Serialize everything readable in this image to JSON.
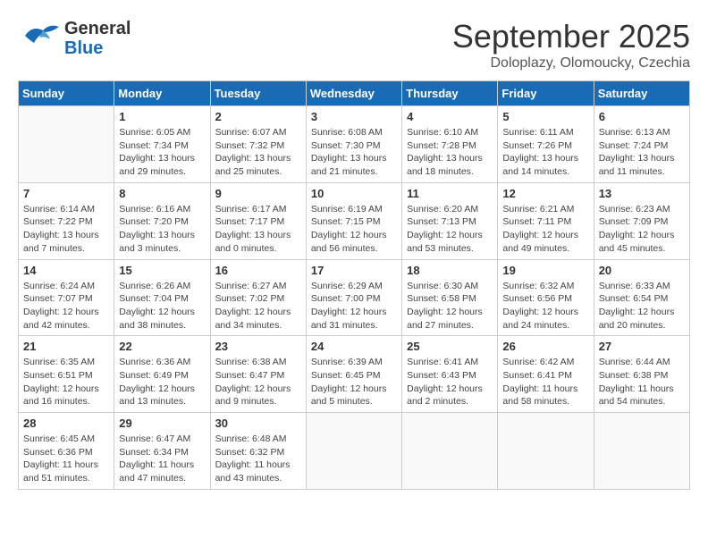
{
  "header": {
    "logo_line1": "General",
    "logo_line2": "Blue",
    "month_title": "September 2025",
    "subtitle": "Doloplazy, Olomoucky, Czechia"
  },
  "days_of_week": [
    "Sunday",
    "Monday",
    "Tuesday",
    "Wednesday",
    "Thursday",
    "Friday",
    "Saturday"
  ],
  "weeks": [
    [
      {
        "day": "",
        "info": ""
      },
      {
        "day": "1",
        "info": "Sunrise: 6:05 AM\nSunset: 7:34 PM\nDaylight: 13 hours\nand 29 minutes."
      },
      {
        "day": "2",
        "info": "Sunrise: 6:07 AM\nSunset: 7:32 PM\nDaylight: 13 hours\nand 25 minutes."
      },
      {
        "day": "3",
        "info": "Sunrise: 6:08 AM\nSunset: 7:30 PM\nDaylight: 13 hours\nand 21 minutes."
      },
      {
        "day": "4",
        "info": "Sunrise: 6:10 AM\nSunset: 7:28 PM\nDaylight: 13 hours\nand 18 minutes."
      },
      {
        "day": "5",
        "info": "Sunrise: 6:11 AM\nSunset: 7:26 PM\nDaylight: 13 hours\nand 14 minutes."
      },
      {
        "day": "6",
        "info": "Sunrise: 6:13 AM\nSunset: 7:24 PM\nDaylight: 13 hours\nand 11 minutes."
      }
    ],
    [
      {
        "day": "7",
        "info": "Sunrise: 6:14 AM\nSunset: 7:22 PM\nDaylight: 13 hours\nand 7 minutes."
      },
      {
        "day": "8",
        "info": "Sunrise: 6:16 AM\nSunset: 7:20 PM\nDaylight: 13 hours\nand 3 minutes."
      },
      {
        "day": "9",
        "info": "Sunrise: 6:17 AM\nSunset: 7:17 PM\nDaylight: 13 hours\nand 0 minutes."
      },
      {
        "day": "10",
        "info": "Sunrise: 6:19 AM\nSunset: 7:15 PM\nDaylight: 12 hours\nand 56 minutes."
      },
      {
        "day": "11",
        "info": "Sunrise: 6:20 AM\nSunset: 7:13 PM\nDaylight: 12 hours\nand 53 minutes."
      },
      {
        "day": "12",
        "info": "Sunrise: 6:21 AM\nSunset: 7:11 PM\nDaylight: 12 hours\nand 49 minutes."
      },
      {
        "day": "13",
        "info": "Sunrise: 6:23 AM\nSunset: 7:09 PM\nDaylight: 12 hours\nand 45 minutes."
      }
    ],
    [
      {
        "day": "14",
        "info": "Sunrise: 6:24 AM\nSunset: 7:07 PM\nDaylight: 12 hours\nand 42 minutes."
      },
      {
        "day": "15",
        "info": "Sunrise: 6:26 AM\nSunset: 7:04 PM\nDaylight: 12 hours\nand 38 minutes."
      },
      {
        "day": "16",
        "info": "Sunrise: 6:27 AM\nSunset: 7:02 PM\nDaylight: 12 hours\nand 34 minutes."
      },
      {
        "day": "17",
        "info": "Sunrise: 6:29 AM\nSunset: 7:00 PM\nDaylight: 12 hours\nand 31 minutes."
      },
      {
        "day": "18",
        "info": "Sunrise: 6:30 AM\nSunset: 6:58 PM\nDaylight: 12 hours\nand 27 minutes."
      },
      {
        "day": "19",
        "info": "Sunrise: 6:32 AM\nSunset: 6:56 PM\nDaylight: 12 hours\nand 24 minutes."
      },
      {
        "day": "20",
        "info": "Sunrise: 6:33 AM\nSunset: 6:54 PM\nDaylight: 12 hours\nand 20 minutes."
      }
    ],
    [
      {
        "day": "21",
        "info": "Sunrise: 6:35 AM\nSunset: 6:51 PM\nDaylight: 12 hours\nand 16 minutes."
      },
      {
        "day": "22",
        "info": "Sunrise: 6:36 AM\nSunset: 6:49 PM\nDaylight: 12 hours\nand 13 minutes."
      },
      {
        "day": "23",
        "info": "Sunrise: 6:38 AM\nSunset: 6:47 PM\nDaylight: 12 hours\nand 9 minutes."
      },
      {
        "day": "24",
        "info": "Sunrise: 6:39 AM\nSunset: 6:45 PM\nDaylight: 12 hours\nand 5 minutes."
      },
      {
        "day": "25",
        "info": "Sunrise: 6:41 AM\nSunset: 6:43 PM\nDaylight: 12 hours\nand 2 minutes."
      },
      {
        "day": "26",
        "info": "Sunrise: 6:42 AM\nSunset: 6:41 PM\nDaylight: 11 hours\nand 58 minutes."
      },
      {
        "day": "27",
        "info": "Sunrise: 6:44 AM\nSunset: 6:38 PM\nDaylight: 11 hours\nand 54 minutes."
      }
    ],
    [
      {
        "day": "28",
        "info": "Sunrise: 6:45 AM\nSunset: 6:36 PM\nDaylight: 11 hours\nand 51 minutes."
      },
      {
        "day": "29",
        "info": "Sunrise: 6:47 AM\nSunset: 6:34 PM\nDaylight: 11 hours\nand 47 minutes."
      },
      {
        "day": "30",
        "info": "Sunrise: 6:48 AM\nSunset: 6:32 PM\nDaylight: 11 hours\nand 43 minutes."
      },
      {
        "day": "",
        "info": ""
      },
      {
        "day": "",
        "info": ""
      },
      {
        "day": "",
        "info": ""
      },
      {
        "day": "",
        "info": ""
      }
    ]
  ]
}
